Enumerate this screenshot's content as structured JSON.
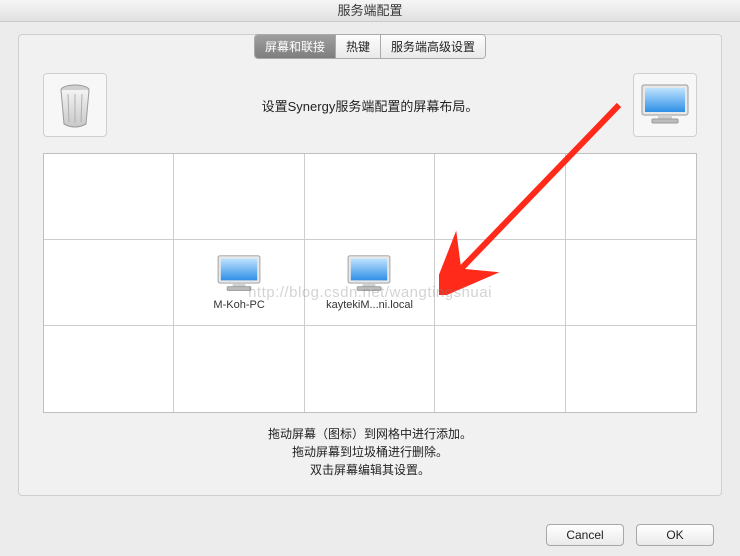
{
  "window": {
    "title": "服务端配置"
  },
  "tabs": {
    "items": [
      {
        "label": "屏幕和联接",
        "active": true
      },
      {
        "label": "热键",
        "active": false
      },
      {
        "label": "服务端高级设置",
        "active": false
      }
    ]
  },
  "instruction": "设置Synergy服务端配置的屏幕布局。",
  "grid": {
    "rows": 3,
    "cols": 5,
    "screens": [
      {
        "row": 1,
        "col": 1,
        "label": "M-Koh-PC"
      },
      {
        "row": 1,
        "col": 2,
        "label": "kaytekiM...ni.local"
      }
    ]
  },
  "hints": {
    "line1": "拖动屏幕（图标）到网格中进行添加。",
    "line2": "拖动屏幕到垃圾桶进行删除。",
    "line3": "双击屏幕编辑其设置。"
  },
  "buttons": {
    "cancel": "Cancel",
    "ok": "OK"
  },
  "icons": {
    "trash": "trash-icon",
    "monitor": "monitor-icon"
  },
  "watermark": "http://blog.csdn.net/wangtingshuai",
  "colors": {
    "arrow": "#ff2a1a"
  }
}
